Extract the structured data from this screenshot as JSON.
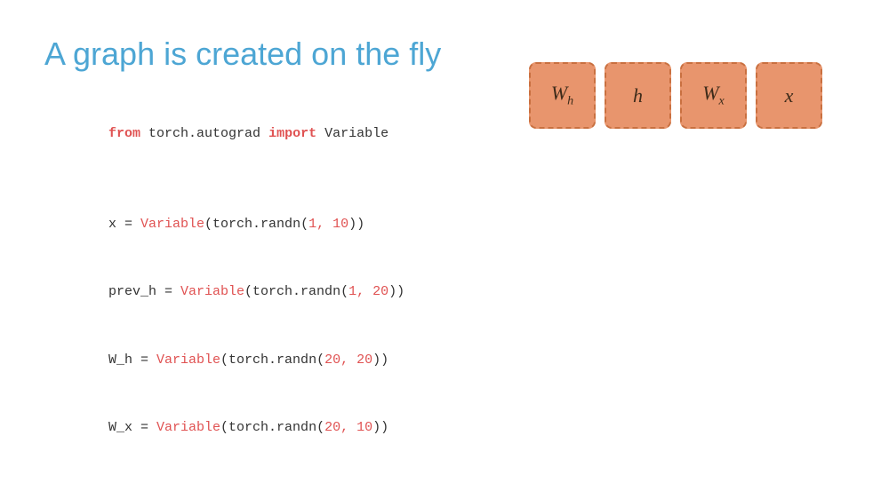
{
  "title": "A graph is created on the fly",
  "code": {
    "line1": "from torch.autograd import Variable",
    "line2": "",
    "line3": "x = Variable(torch.randn(1, 10))",
    "line4": "prev_h = Variable(torch.randn(1, 20))",
    "line5": "W_h = Variable(torch.randn(20, 20))",
    "line6": "W_x = Variable(torch.randn(20, 10))"
  },
  "boxes": [
    {
      "label": "W",
      "sub": "h",
      "id": "wh"
    },
    {
      "label": "h",
      "sub": "",
      "id": "h"
    },
    {
      "label": "W",
      "sub": "x",
      "id": "wx"
    },
    {
      "label": "x",
      "sub": "",
      "id": "x"
    }
  ],
  "colors": {
    "title": "#4da6d4",
    "keyword_red": "#e05252",
    "text_dark": "#333333",
    "box_bg": "#e8956d",
    "box_border": "#c97040"
  }
}
